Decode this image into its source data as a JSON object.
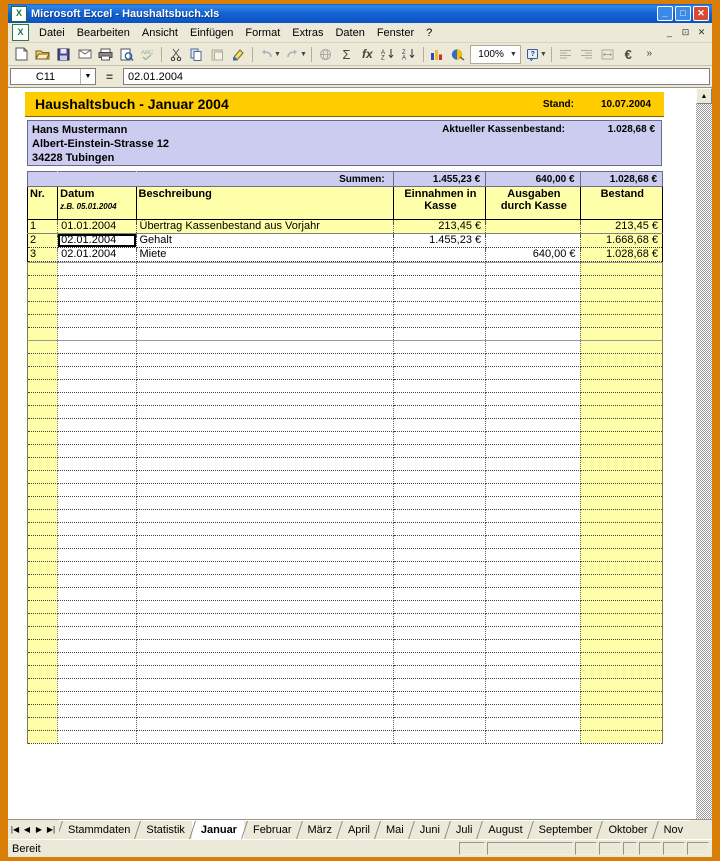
{
  "window": {
    "title": "Microsoft Excel - Haushaltsbuch.xls",
    "app_icon": "excel-icon",
    "minimize": "_",
    "maximize": "□",
    "close": "✕",
    "doc_minimize": "_",
    "doc_restore": "⊡",
    "doc_close": "✕"
  },
  "menubar": {
    "items": [
      {
        "label": "Datei",
        "accel": "D"
      },
      {
        "label": "Bearbeiten",
        "accel": "B"
      },
      {
        "label": "Ansicht",
        "accel": "A"
      },
      {
        "label": "Einfügen",
        "accel": "E"
      },
      {
        "label": "Format",
        "accel": "t"
      },
      {
        "label": "Extras",
        "accel": "x"
      },
      {
        "label": "Daten",
        "accel": "n"
      },
      {
        "label": "Fenster",
        "accel": "F"
      },
      {
        "label": "?",
        "accel": "?"
      }
    ]
  },
  "toolbar": {
    "buttons": [
      {
        "name": "new-icon",
        "glyph": "🗋"
      },
      {
        "name": "open-icon",
        "glyph": "📂"
      },
      {
        "name": "save-icon",
        "glyph": "💾"
      },
      {
        "name": "email-icon",
        "glyph": "✉"
      },
      {
        "name": "print-icon",
        "glyph": "🖶"
      },
      {
        "name": "print-preview-icon",
        "glyph": "🔍"
      },
      {
        "name": "spelling-icon",
        "glyph": "ABC"
      },
      {
        "name": "cut-icon",
        "glyph": "✂"
      },
      {
        "name": "copy-icon",
        "glyph": "⧉"
      },
      {
        "name": "paste-icon",
        "glyph": "📋"
      },
      {
        "name": "format-painter-icon",
        "glyph": "🖌"
      },
      {
        "name": "undo-icon",
        "glyph": "↶"
      },
      {
        "name": "redo-icon",
        "glyph": "↷"
      },
      {
        "name": "hyperlink-icon",
        "glyph": "🌐"
      },
      {
        "name": "autosum-icon",
        "glyph": "Σ"
      },
      {
        "name": "function-wizard-icon",
        "glyph": "fx"
      },
      {
        "name": "sort-ascending-icon",
        "glyph": "A↓"
      },
      {
        "name": "sort-descending-icon",
        "glyph": "Z↓"
      },
      {
        "name": "chart-wizard-icon",
        "glyph": "📊"
      },
      {
        "name": "drawing-icon",
        "glyph": "🎨"
      }
    ],
    "zoom_value": "100%",
    "zoom_dropdown": "▼",
    "help_icon": "?",
    "align_left_icon": "≡",
    "align_right_icon": "≡",
    "merge-cells-icon": "⊞",
    "euro_icon": "€",
    "overflow_icon": "»"
  },
  "formula_bar": {
    "name_box_value": "C11",
    "name_box_arrow": "▼",
    "cancel_icon": "✕",
    "enter_icon": "✓",
    "equals_icon": "=",
    "formula_value": "02.01.2004"
  },
  "sheet": {
    "banner": {
      "title": "Haushaltsbuch - Januar 2004",
      "stand_label": "Stand:",
      "stand_value": "10.07.2004"
    },
    "address": {
      "line1": "Hans Mustermann",
      "line2": "Albert-Einstein-Strasse 12",
      "line3": "34228 Tubingen",
      "balance_label": "Aktueller Kassenbestand:",
      "balance_value": "1.028,68 €"
    },
    "totals": {
      "label": "Summen:",
      "einnahmen": "1.455,23 €",
      "ausgaben": "640,00 €",
      "bestand": "1.028,68 €"
    },
    "headers": {
      "nr": "Nr.",
      "datum": "Datum",
      "datum_hint": "z.B. 05.01.2004",
      "beschreibung": "Beschreibung",
      "einnahmen_l1": "Einnahmen in",
      "einnahmen_l2": "Kasse",
      "ausgaben_l1": "Ausgaben",
      "ausgaben_l2": "durch Kasse",
      "bestand": "Bestand"
    },
    "rows": [
      {
        "nr": "1",
        "datum": "01.01.2004",
        "beschreibung": "Übertrag Kassenbestand aus Vorjahr",
        "einnahmen": "213,45 €",
        "ausgaben": "",
        "bestand": "213,45 €",
        "selected": false
      },
      {
        "nr": "2",
        "datum": "02.01.2004",
        "beschreibung": "Gehalt",
        "einnahmen": "1.455,23 €",
        "ausgaben": "",
        "bestand": "1.668,68 €",
        "selected": true
      },
      {
        "nr": "3",
        "datum": "02.01.2004",
        "beschreibung": "Miete",
        "einnahmen": "",
        "ausgaben": "640,00 €",
        "bestand": "1.028,68 €",
        "selected": false
      }
    ],
    "empty_row_count": 41,
    "colors": {
      "banner": "#ffcc00",
      "header_yellow": "#ffffaa",
      "address_lavender": "#ccccf0",
      "window_frame": "#d97f07",
      "titlebar_blue": "#1563d6"
    }
  },
  "scrollbar": {
    "up_arrow": "▲",
    "down_arrow": "▼"
  },
  "tabbar": {
    "nav": {
      "first": "|◀",
      "prev": "◀",
      "next": "▶",
      "last": "▶|"
    },
    "tabs": [
      {
        "label": "Stammdaten",
        "active": false
      },
      {
        "label": "Statistik",
        "active": false
      },
      {
        "label": "Januar",
        "active": true
      },
      {
        "label": "Februar",
        "active": false
      },
      {
        "label": "März",
        "active": false
      },
      {
        "label": "April",
        "active": false
      },
      {
        "label": "Mai",
        "active": false
      },
      {
        "label": "Juni",
        "active": false
      },
      {
        "label": "Juli",
        "active": false
      },
      {
        "label": "August",
        "active": false
      },
      {
        "label": "September",
        "active": false
      },
      {
        "label": "Oktober",
        "active": false
      },
      {
        "label": "Nov",
        "active": false
      }
    ]
  },
  "statusbar": {
    "message": "Bereit",
    "panels": [
      "",
      "",
      "",
      "",
      "",
      "",
      "",
      ""
    ]
  }
}
